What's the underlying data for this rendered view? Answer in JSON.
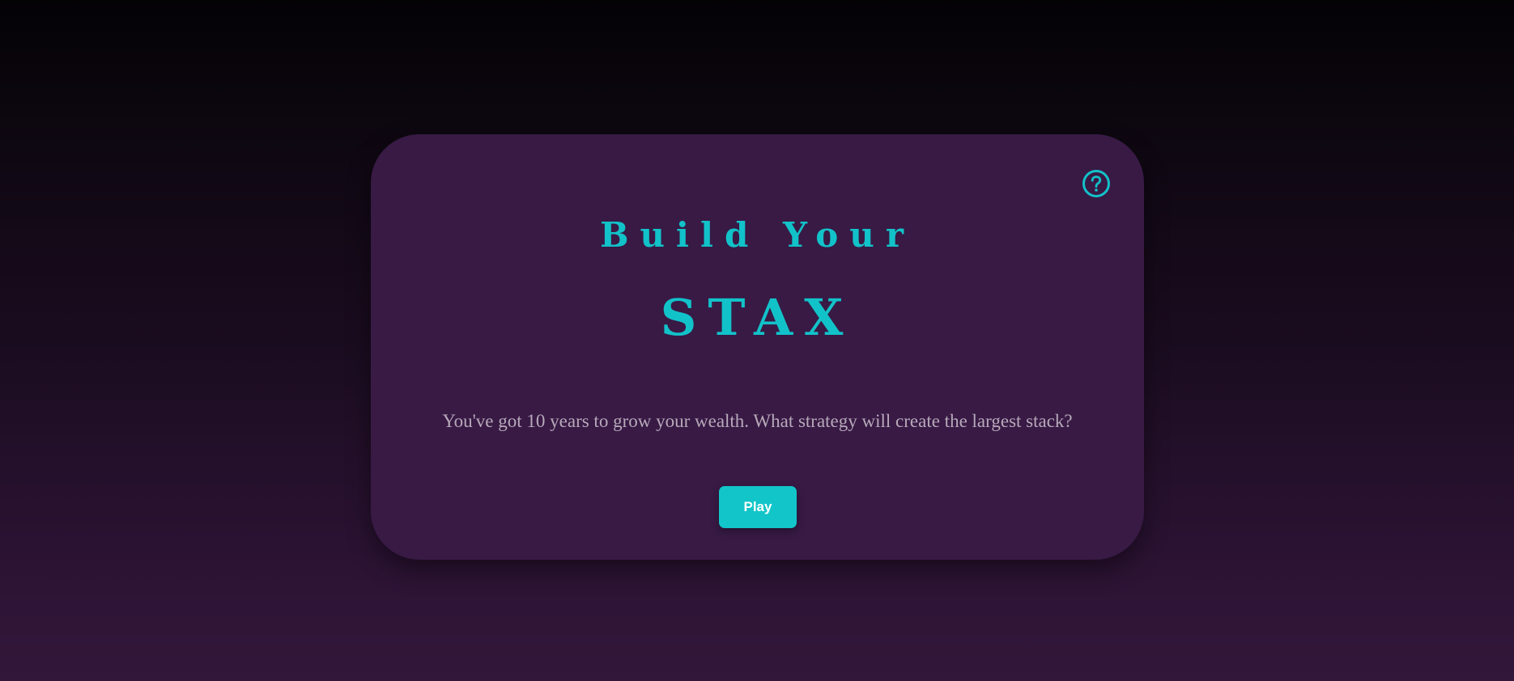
{
  "intro_card": {
    "title_line1": "Build Your",
    "title_line2": "STAX",
    "description": "You've got 10 years to grow your wealth. What strategy will create the largest stack?",
    "play_label": "Play",
    "help_icon": "question-circle-icon"
  },
  "colors": {
    "accent": "#12c2c9",
    "card_background": "#381a45",
    "text_muted": "#b7a9b9",
    "page_background_top": "#030205",
    "page_background_bottom": "#33173a"
  }
}
